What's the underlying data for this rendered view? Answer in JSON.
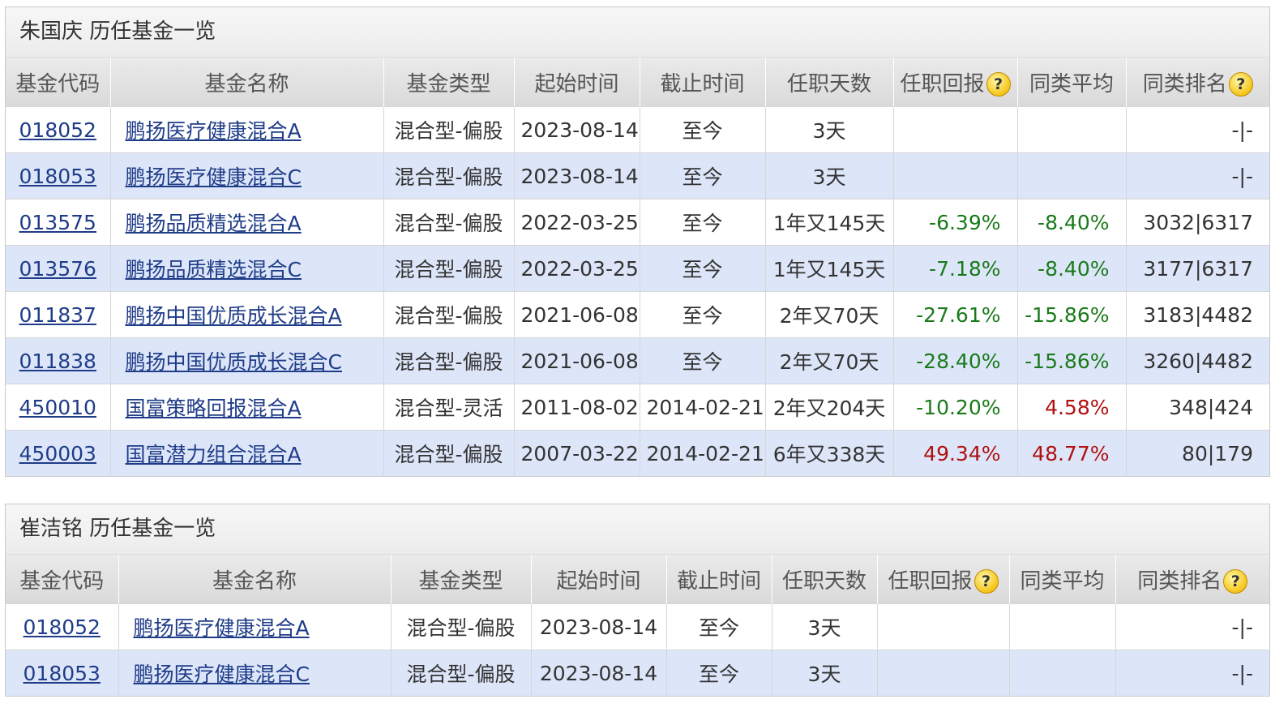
{
  "panels": [
    {
      "title": "朱国庆  历任基金一览",
      "headers": [
        "基金代码",
        "基金名称",
        "基金类型",
        "起始时间",
        "截止时间",
        "任职天数",
        "任职回报",
        "同类平均",
        "同类排名"
      ],
      "rows": [
        {
          "code": "018052",
          "name": "鹏扬医疗健康混合A",
          "type": "混合型-偏股",
          "start": "2023-08-14",
          "end": "至今",
          "days": "3天",
          "ret": "",
          "avg": "",
          "rank": "-|-"
        },
        {
          "code": "018053",
          "name": "鹏扬医疗健康混合C",
          "type": "混合型-偏股",
          "start": "2023-08-14",
          "end": "至今",
          "days": "3天",
          "ret": "",
          "avg": "",
          "rank": "-|-"
        },
        {
          "code": "013575",
          "name": "鹏扬品质精选混合A",
          "type": "混合型-偏股",
          "start": "2022-03-25",
          "end": "至今",
          "days": "1年又145天",
          "ret": "-6.39%",
          "avg": "-8.40%",
          "rank": "3032|6317"
        },
        {
          "code": "013576",
          "name": "鹏扬品质精选混合C",
          "type": "混合型-偏股",
          "start": "2022-03-25",
          "end": "至今",
          "days": "1年又145天",
          "ret": "-7.18%",
          "avg": "-8.40%",
          "rank": "3177|6317"
        },
        {
          "code": "011837",
          "name": "鹏扬中国优质成长混合A",
          "type": "混合型-偏股",
          "start": "2021-06-08",
          "end": "至今",
          "days": "2年又70天",
          "ret": "-27.61%",
          "avg": "-15.86%",
          "rank": "3183|4482"
        },
        {
          "code": "011838",
          "name": "鹏扬中国优质成长混合C",
          "type": "混合型-偏股",
          "start": "2021-06-08",
          "end": "至今",
          "days": "2年又70天",
          "ret": "-28.40%",
          "avg": "-15.86%",
          "rank": "3260|4482"
        },
        {
          "code": "450010",
          "name": "国富策略回报混合A",
          "type": "混合型-灵活",
          "start": "2011-08-02",
          "end": "2014-02-21",
          "days": "2年又204天",
          "ret": "-10.20%",
          "avg": "4.58%",
          "rank": "348|424"
        },
        {
          "code": "450003",
          "name": "国富潜力组合混合A",
          "type": "混合型-偏股",
          "start": "2007-03-22",
          "end": "2014-02-21",
          "days": "6年又338天",
          "ret": "49.34%",
          "avg": "48.77%",
          "rank": "80|179"
        }
      ]
    },
    {
      "title": "崔洁铭  历任基金一览",
      "headers": [
        "基金代码",
        "基金名称",
        "基金类型",
        "起始时间",
        "截止时间",
        "任职天数",
        "任职回报",
        "同类平均",
        "同类排名"
      ],
      "rows": [
        {
          "code": "018052",
          "name": "鹏扬医疗健康混合A",
          "type": "混合型-偏股",
          "start": "2023-08-14",
          "end": "至今",
          "days": "3天",
          "ret": "",
          "avg": "",
          "rank": "-|-"
        },
        {
          "code": "018053",
          "name": "鹏扬医疗健康混合C",
          "type": "混合型-偏股",
          "start": "2023-08-14",
          "end": "至今",
          "days": "3天",
          "ret": "",
          "avg": "",
          "rank": "-|-"
        }
      ]
    }
  ],
  "help_icon_glyph": "?",
  "colors": {
    "positive": "#b01010",
    "negative": "#1a7a1a",
    "link": "#1f3c88",
    "alt_row": "#dde6f9"
  }
}
